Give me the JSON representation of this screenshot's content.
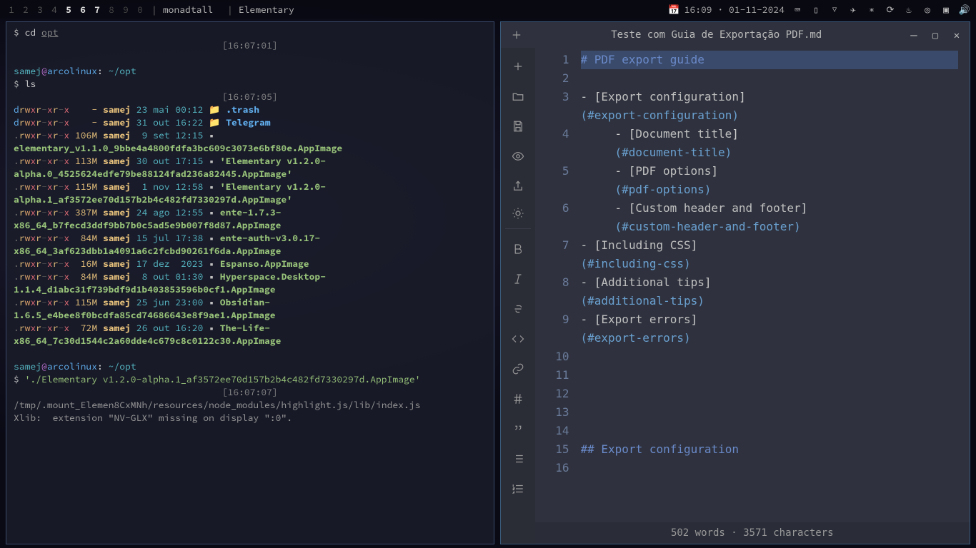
{
  "topbar": {
    "workspaces": [
      "1",
      "2",
      "3",
      "4",
      "5",
      "6",
      "7",
      "8",
      "9",
      "0"
    ],
    "active_ws": [
      4,
      5,
      6
    ],
    "layout": "monadtall",
    "app_title": "Elementary",
    "clock": "16:09 · 01-11-2024",
    "calendar_icon": "📅"
  },
  "terminal": {
    "prompt_user": "samej",
    "prompt_host": "arcolinux",
    "prompt_path": "~/opt",
    "lines": [
      {
        "type": "cmd",
        "text": "cd",
        "arg": "opt"
      },
      {
        "type": "ts",
        "text": "[16:07:01]"
      },
      {
        "type": "blank"
      },
      {
        "type": "prompt"
      },
      {
        "type": "cmd",
        "text": "ls"
      },
      {
        "type": "ts",
        "text": "[16:07:05]"
      },
      {
        "type": "ls",
        "perm": "drwxr-xr-x",
        "size": "-",
        "owner": "samej",
        "date": "23 mai 00:12",
        "icon": "📁",
        "name": ".trash",
        "cls": "fold"
      },
      {
        "type": "ls",
        "perm": "drwxr-xr-x",
        "size": "-",
        "owner": "samej",
        "date": "31 out 16:22",
        "icon": "📁",
        "name": "Telegram",
        "cls": "fold"
      },
      {
        "type": "ls",
        "perm": ".rwxr-xr-x",
        "size": "106M",
        "owner": "samej",
        "date": " 9 set 12:15",
        "icon": "▪",
        "name": "elementary_v1.1.0_9bbe4a4800fdfa3bc609c3073e6bf80e.AppImage",
        "cls": "exe"
      },
      {
        "type": "ls",
        "perm": ".rwxr-xr-x",
        "size": "113M",
        "owner": "samej",
        "date": "30 out 17:15",
        "icon": "▪",
        "name": "'Elementary v1.2.0-alpha.0_4525624edfe79be88124fad236a82445.AppImage'",
        "cls": "exe"
      },
      {
        "type": "ls",
        "perm": ".rwxr-xr-x",
        "size": "115M",
        "owner": "samej",
        "date": " 1 nov 12:58",
        "icon": "▪",
        "name": "'Elementary v1.2.0-alpha.1_af3572ee70d157b2b4c482fd7330297d.AppImage'",
        "cls": "exe"
      },
      {
        "type": "ls",
        "perm": ".rwxr-xr-x",
        "size": "387M",
        "owner": "samej",
        "date": "24 ago 12:55",
        "icon": "▪",
        "name": "ente-1.7.3-x86_64_b7fecd3ddf9bb7b0c5ad5e9b007f8d87.AppImage",
        "cls": "exe"
      },
      {
        "type": "ls",
        "perm": ".rwxr-xr-x",
        "size": " 84M",
        "owner": "samej",
        "date": "15 jul 17:38",
        "icon": "▪",
        "name": "ente-auth-v3.0.17-x86_64_3af623dbb1a4091a6c2fcbd90261f6da.AppImage",
        "cls": "exe"
      },
      {
        "type": "ls",
        "perm": ".rwxr-xr-x",
        "size": " 16M",
        "owner": "samej",
        "date": "17 dez  2023",
        "icon": "▪",
        "name": "Espanso.AppImage",
        "cls": "exe"
      },
      {
        "type": "ls",
        "perm": ".rwxr-xr-x",
        "size": " 84M",
        "owner": "samej",
        "date": " 8 out 01:30",
        "icon": "▪",
        "name": "Hyperspace.Desktop-1.1.4_d1abc31f739bdf9d1b403853596b0cf1.AppImage",
        "cls": "exe"
      },
      {
        "type": "ls",
        "perm": ".rwxr-xr-x",
        "size": "115M",
        "owner": "samej",
        "date": "25 jun 23:00",
        "icon": "▪",
        "name": "Obsidian-1.6.5_e4bee8f0bcdfa85cd74686643e8f9ae1.AppImage",
        "cls": "exe"
      },
      {
        "type": "ls",
        "perm": ".rwxr-xr-x",
        "size": " 72M",
        "owner": "samej",
        "date": "26 out 16:20",
        "icon": "▪",
        "name": "The-Life-x86_64_7c30d1544c2a60dde4c679c8c0122c30.AppImage",
        "cls": "exe"
      },
      {
        "type": "blank"
      },
      {
        "type": "prompt"
      },
      {
        "type": "cmdraw",
        "text": "$ ",
        "str": "'./Elementary v1.2.0-alpha.1_af3572ee70d157b2b4c482fd7330297d.AppImage'"
      },
      {
        "type": "ts",
        "text": "[16:07:07]"
      },
      {
        "type": "out",
        "text": "/tmp/.mount_Elemen8CxMNh/resources/node_modules/highlight.js/lib/index.js"
      },
      {
        "type": "out",
        "text": "Xlib:  extension \"NV-GLX\" missing on display \":0\"."
      }
    ]
  },
  "editor": {
    "title": "Teste com Guia de Exportação PDF.md",
    "sidebar_icons": [
      "plus",
      "folder",
      "save",
      "eye",
      "share",
      "gear",
      "bold",
      "italic",
      "strike",
      "code",
      "link",
      "hash",
      "quote",
      "ul",
      "ol",
      "dots"
    ],
    "lines": [
      {
        "n": 1,
        "hl": true,
        "segs": [
          {
            "c": "tok-h",
            "t": "# "
          },
          {
            "c": "tok-h",
            "t": "PDF export guide"
          }
        ]
      },
      {
        "n": 2,
        "segs": []
      },
      {
        "n": 3,
        "segs": [
          {
            "c": "tok-pun",
            "t": "- ["
          },
          {
            "c": "tok-link",
            "t": "Export configuration"
          },
          {
            "c": "tok-pun",
            "t": "]"
          }
        ]
      },
      {
        "n": 3.5,
        "cont": true,
        "segs": [
          {
            "c": "tok-anch",
            "t": "(#export-configuration)"
          }
        ]
      },
      {
        "n": 4,
        "ind": 1,
        "segs": [
          {
            "c": "tok-pun",
            "t": "- ["
          },
          {
            "c": "tok-link",
            "t": "Document title"
          },
          {
            "c": "tok-pun",
            "t": "]"
          }
        ]
      },
      {
        "n": 4.5,
        "cont": true,
        "ind": 1,
        "segs": [
          {
            "c": "tok-anch",
            "t": "(#document-title)"
          }
        ]
      },
      {
        "n": 5,
        "ind": 1,
        "segs": [
          {
            "c": "tok-pun",
            "t": "- ["
          },
          {
            "c": "tok-link",
            "t": "PDF options"
          },
          {
            "c": "tok-pun",
            "t": "]"
          }
        ]
      },
      {
        "n": 5.5,
        "cont": true,
        "ind": 1,
        "segs": [
          {
            "c": "tok-anch",
            "t": "(#pdf-options)"
          }
        ]
      },
      {
        "n": 6,
        "ind": 1,
        "segs": [
          {
            "c": "tok-pun",
            "t": "- ["
          },
          {
            "c": "tok-link",
            "t": "Custom header and footer"
          },
          {
            "c": "tok-pun",
            "t": "]"
          }
        ]
      },
      {
        "n": 6.5,
        "cont": true,
        "ind": 1,
        "segs": [
          {
            "c": "tok-anch",
            "t": "(#custom-header-and-footer)"
          }
        ]
      },
      {
        "n": 7,
        "segs": [
          {
            "c": "tok-pun",
            "t": "- ["
          },
          {
            "c": "tok-link",
            "t": "Including CSS"
          },
          {
            "c": "tok-pun",
            "t": "]"
          }
        ]
      },
      {
        "n": 7.5,
        "cont": true,
        "segs": [
          {
            "c": "tok-anch",
            "t": "(#including-css)"
          }
        ]
      },
      {
        "n": 8,
        "segs": [
          {
            "c": "tok-pun",
            "t": "- ["
          },
          {
            "c": "tok-link",
            "t": "Additional tips"
          },
          {
            "c": "tok-pun",
            "t": "]"
          }
        ]
      },
      {
        "n": 8.5,
        "cont": true,
        "segs": [
          {
            "c": "tok-anch",
            "t": "(#additional-tips)"
          }
        ]
      },
      {
        "n": 9,
        "segs": [
          {
            "c": "tok-pun",
            "t": "- ["
          },
          {
            "c": "tok-link",
            "t": "Export errors"
          },
          {
            "c": "tok-pun",
            "t": "]"
          }
        ]
      },
      {
        "n": 9.5,
        "cont": true,
        "segs": [
          {
            "c": "tok-anch",
            "t": "(#export-errors)"
          }
        ]
      },
      {
        "n": 10,
        "segs": []
      },
      {
        "n": 11,
        "segs": []
      },
      {
        "n": 12,
        "segs": []
      },
      {
        "n": 13,
        "segs": []
      },
      {
        "n": 14,
        "segs": []
      },
      {
        "n": 15,
        "segs": [
          {
            "c": "tok-h",
            "t": "## "
          },
          {
            "c": "tok-h",
            "t": "Export configuration"
          }
        ]
      },
      {
        "n": 16,
        "segs": []
      }
    ],
    "status": "502 words · 3571 characters"
  }
}
